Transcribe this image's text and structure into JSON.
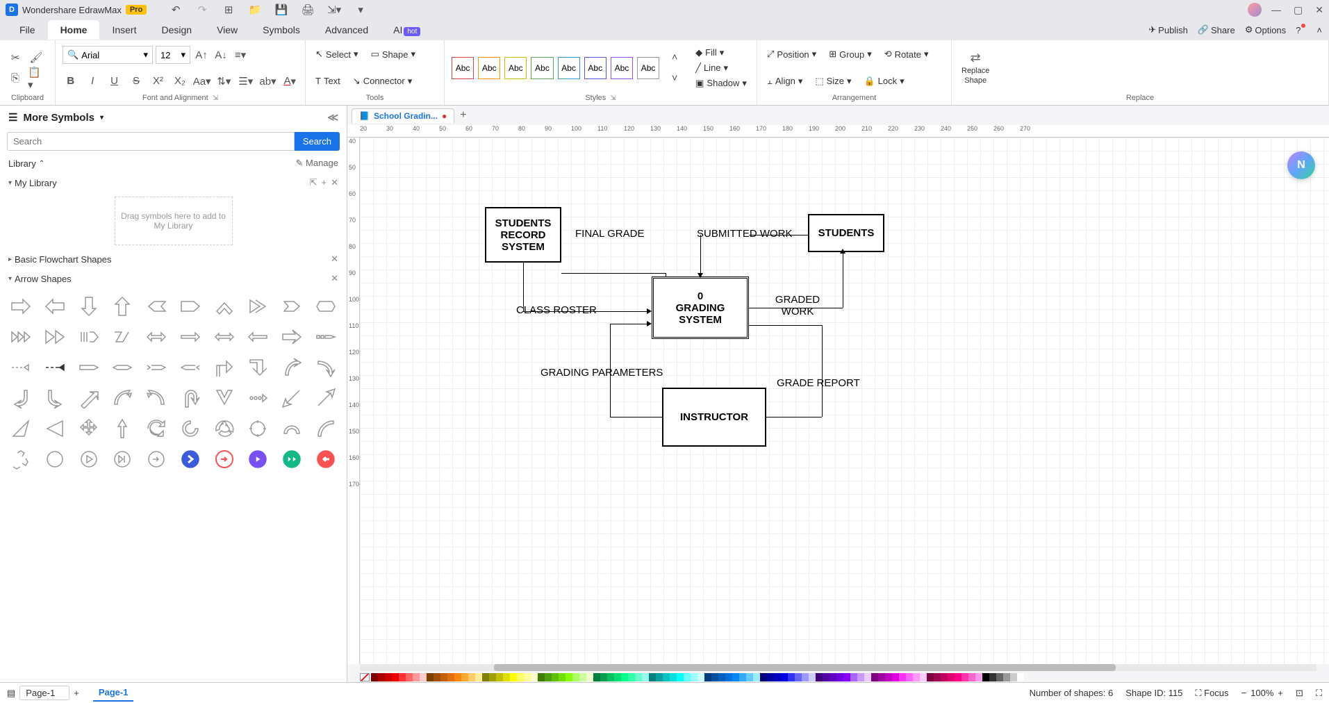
{
  "app": {
    "name": "Wondershare EdrawMax",
    "badge": "Pro"
  },
  "menubar": {
    "tabs": [
      "File",
      "Home",
      "Insert",
      "Design",
      "View",
      "Symbols",
      "Advanced",
      "AI"
    ],
    "active": "Home",
    "publish": "Publish",
    "share": "Share",
    "options": "Options"
  },
  "ribbon": {
    "clipboard_label": "Clipboard",
    "font_name": "Arial",
    "font_size": "12",
    "font_label": "Font and Alignment",
    "select": "Select",
    "shape": "Shape",
    "text": "Text",
    "connector": "Connector",
    "tools_label": "Tools",
    "style_swatch": "Abc",
    "styles_label": "Styles",
    "fill": "Fill",
    "line": "Line",
    "shadow": "Shadow",
    "position": "Position",
    "group": "Group",
    "rotate": "Rotate",
    "align": "Align",
    "size": "Size",
    "lock": "Lock",
    "arrangement_label": "Arrangement",
    "replace": "Replace",
    "replace_shape": "Shape",
    "replace_label": "Replace"
  },
  "leftpanel": {
    "title": "More Symbols",
    "search_placeholder": "Search",
    "search_btn": "Search",
    "library": "Library",
    "manage": "Manage",
    "my_library": "My Library",
    "my_library_hint": "Drag symbols here to add to My Library",
    "basic_flowchart": "Basic Flowchart Shapes",
    "arrow_shapes": "Arrow Shapes"
  },
  "doc": {
    "tab_name": "School Gradin..."
  },
  "ruler_h": [
    "20",
    "30",
    "40",
    "50",
    "60",
    "70",
    "80",
    "90",
    "100",
    "110",
    "120",
    "130",
    "140",
    "150",
    "160",
    "170",
    "180",
    "190",
    "200",
    "210",
    "220",
    "230",
    "240",
    "250",
    "260",
    "270"
  ],
  "ruler_v": [
    "40",
    "50",
    "60",
    "70",
    "80",
    "90",
    "100",
    "110",
    "120",
    "130",
    "140",
    "150",
    "160",
    "170"
  ],
  "diagram": {
    "students_record_system": "STUDENTS RECORD SYSTEM",
    "final_grade": "FINAL GRADE",
    "submitted_work": "SUBMITTED WORK",
    "students": "STUDENTS",
    "class_roster": "CLASS ROSTER",
    "grading_system_num": "0",
    "grading_system_line2": "GRADING",
    "grading_system_line3": "SYSTEM",
    "graded_work": "GRADED WORK",
    "grading_parameters": "GRADING PARAMETERS",
    "grade_report": "GRADE REPORT",
    "instructor": "INSTRUCTOR"
  },
  "colorbar": [
    "#7f0000",
    "#a00",
    "#c00",
    "#e00",
    "#f33",
    "#f66",
    "#f99",
    "#fcc",
    "#7f3f00",
    "#a05000",
    "#c06000",
    "#e07000",
    "#f80",
    "#fa3",
    "#fc6",
    "#fe9",
    "#7f7f00",
    "#a0a000",
    "#c0c000",
    "#e0e000",
    "#ff0",
    "#ff6",
    "#ff9",
    "#ffc",
    "#3f7f00",
    "#50a000",
    "#60c000",
    "#70e000",
    "#8f0",
    "#af6",
    "#cf9",
    "#efc",
    "#007f3f",
    "#00a050",
    "#00c060",
    "#00e070",
    "#0f8",
    "#3fa",
    "#6fc",
    "#9fe",
    "#007f7f",
    "#00a0a0",
    "#00c0c0",
    "#00e0e0",
    "#0ff",
    "#6ff",
    "#9ff",
    "#cff",
    "#003f7f",
    "#0050a0",
    "#0060c0",
    "#0070e0",
    "#08f",
    "#3af",
    "#6cf",
    "#9ef",
    "#00007f",
    "#0000a0",
    "#0000c0",
    "#0000e0",
    "#33f",
    "#66f",
    "#99f",
    "#ccf",
    "#3f007f",
    "#5000a0",
    "#6000c0",
    "#7000e0",
    "#80f",
    "#a6f",
    "#c9f",
    "#ecf",
    "#7f007f",
    "#a000a0",
    "#c000c0",
    "#e000e0",
    "#f3f",
    "#f6f",
    "#f9f",
    "#fcf",
    "#7f003f",
    "#a00050",
    "#c00060",
    "#e00070",
    "#f08",
    "#f3a",
    "#f6c",
    "#f9e",
    "#000",
    "#333",
    "#666",
    "#999",
    "#ccc",
    "#fff"
  ],
  "status": {
    "page_list": "Page-1",
    "page_tab": "Page-1",
    "shapes": "Number of shapes: 6",
    "shape_id": "Shape ID: 115",
    "focus": "Focus",
    "zoom": "100%"
  }
}
